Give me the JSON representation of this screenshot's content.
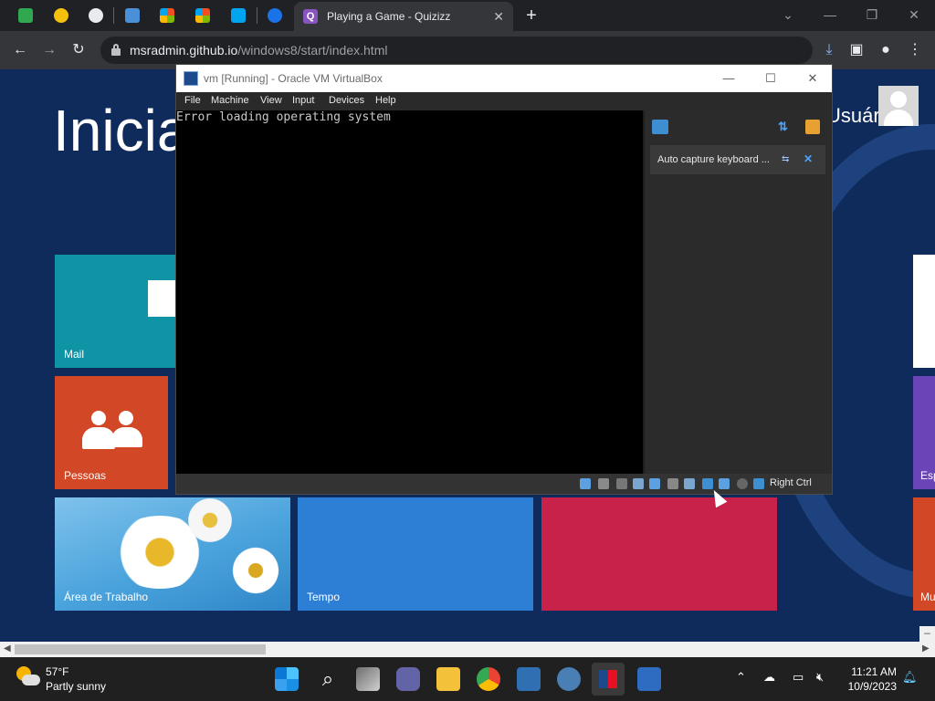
{
  "browser": {
    "active_tab": {
      "title": "Playing a Game - Quizizz",
      "favicon": "Q"
    },
    "url": {
      "host": "msradmin.github.io",
      "path": "/windows8/start/index.html"
    },
    "colors": {
      "accent": "#8ab4f8",
      "quizizz": "#8854c0"
    }
  },
  "start_page": {
    "title": "Iniciar",
    "user_label": "Usuário",
    "tiles": {
      "mail": "Mail",
      "people": "Pessoas",
      "desktop": "Área de Trabalho",
      "weather": "Tempo",
      "right_1": "Esp",
      "right_2": "Mu"
    }
  },
  "virtualbox": {
    "title": "vm [Running] - Oracle VM VirtualBox",
    "menu": [
      "File",
      "Machine",
      "View",
      "Input",
      "Devices",
      "Help"
    ],
    "screen_text": "Error loading operating system",
    "notice": "Auto capture keyboard ...",
    "host_key": "Right Ctrl"
  },
  "taskbar": {
    "weather": {
      "temp": "57°F",
      "condition": "Partly sunny"
    },
    "time": "11:21 AM",
    "date": "10/9/2023"
  }
}
